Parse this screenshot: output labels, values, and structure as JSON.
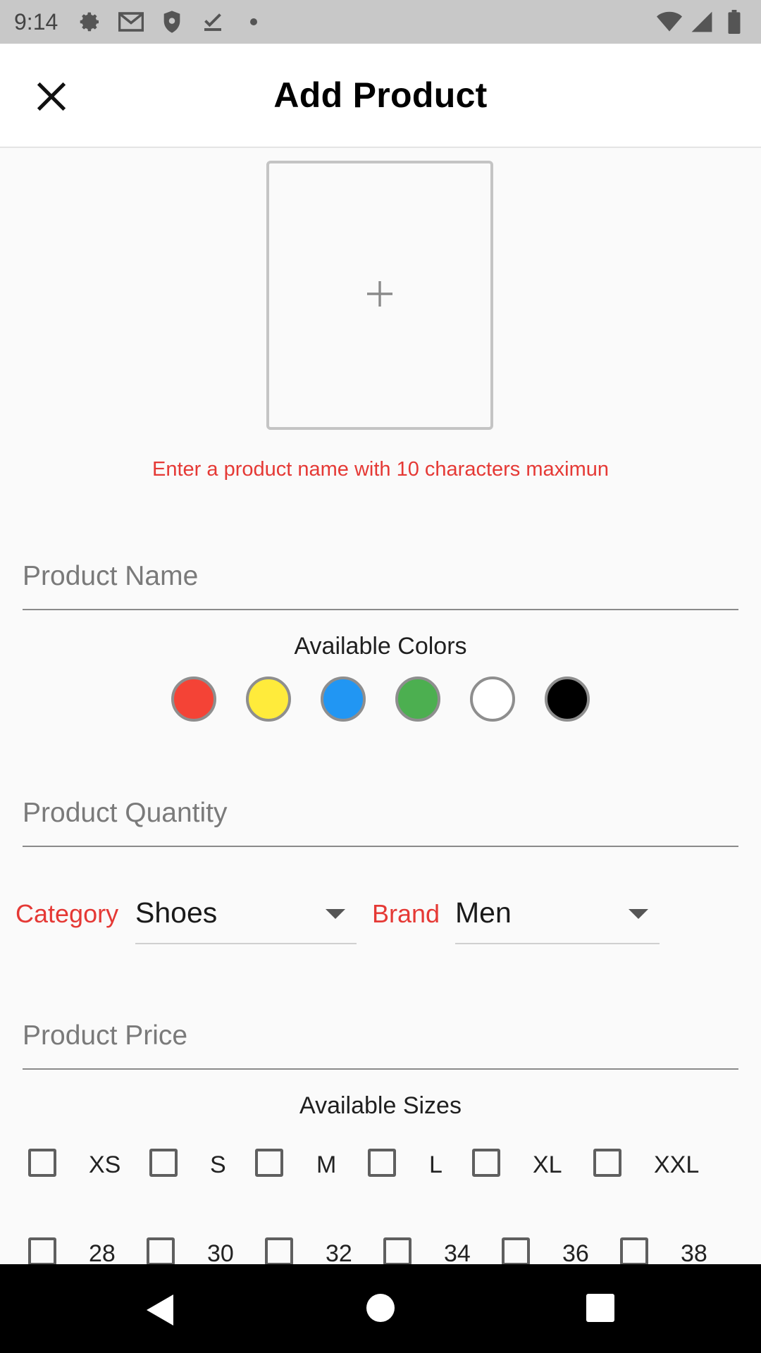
{
  "status_bar": {
    "time": "9:14",
    "icons_left": [
      "gear-icon",
      "gmail-icon",
      "shield-icon",
      "download-done-icon",
      "dot-icon"
    ],
    "icons_right": [
      "wifi-icon",
      "signal-icon",
      "battery-icon"
    ]
  },
  "app_bar": {
    "title": "Add Product",
    "close_icon": "close-icon"
  },
  "image_picker": {
    "icon": "plus-icon"
  },
  "hint_text": "Enter a product name with 10 characters maximun",
  "fields": {
    "name_placeholder": "Product Name",
    "quantity_placeholder": "Product Quantity",
    "price_placeholder": "Product Price"
  },
  "colors": {
    "title": "Available Colors",
    "swatches": [
      "#f44336",
      "#ffeb3b",
      "#2196f3",
      "#4caf50",
      "#ffffff",
      "#000000"
    ]
  },
  "category": {
    "label": "Category",
    "value": "Shoes"
  },
  "brand": {
    "label": "Brand",
    "value": "Men"
  },
  "sizes": {
    "title": "Available Sizes",
    "row1": [
      "XS",
      "S",
      "M",
      "L",
      "XL",
      "XXL"
    ],
    "row2": [
      "28",
      "30",
      "32",
      "34",
      "36",
      "38"
    ]
  },
  "accent_color": "#e53935",
  "nav_bar": {
    "icons": [
      "back-icon",
      "home-icon",
      "recents-icon"
    ]
  }
}
